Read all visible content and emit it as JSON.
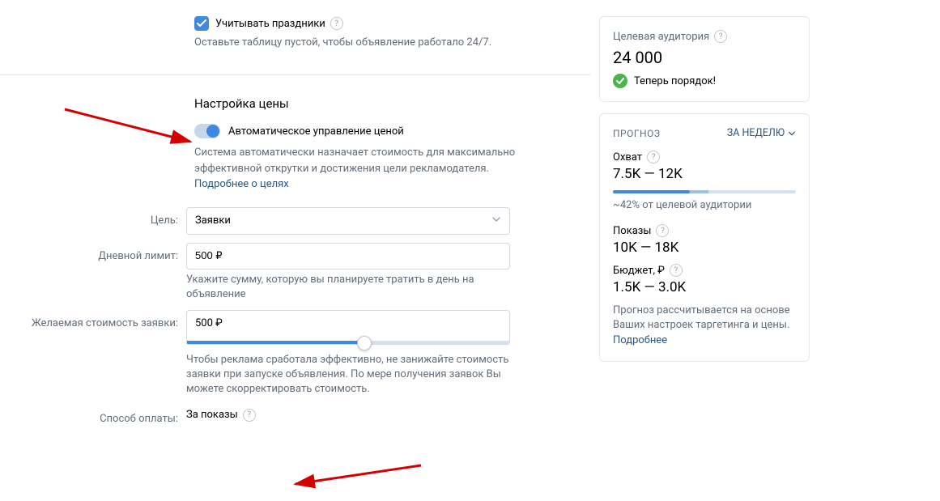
{
  "holidays": {
    "checkbox_label": "Учитывать праздники",
    "hint": "Оставьте таблицу пустой, чтобы объявление работало 24/7."
  },
  "price_section": {
    "title": "Настройка цены",
    "auto_toggle_label": "Автоматическое управление ценой",
    "auto_desc_prefix": "Система автоматически назначает стоимость для максимально эффективной открутки и достижения цели рекламодателя. ",
    "auto_desc_link": "Подробнее о целях"
  },
  "goal": {
    "label": "Цель:",
    "value": "Заявки"
  },
  "daily_limit": {
    "label": "Дневной лимит:",
    "value": "500 ₽",
    "hint": "Укажите сумму, которую вы планируете тратить в день на объявление"
  },
  "desired_cost": {
    "label": "Желаемая стоимость заявки:",
    "value": "500 ₽",
    "hint": "Чтобы реклама сработала эффективно, не занижайте стоимость заявки при запуске объявления. По мере получения заявок Вы можете скорректировать стоимость."
  },
  "payment": {
    "label": "Способ оплаты:",
    "value": "За показы"
  },
  "audience": {
    "title": "Целевая аудитория",
    "value": "24 000",
    "ok_text": "Теперь порядок!"
  },
  "forecast": {
    "title": "ПРОГНОЗ",
    "period": "ЗА НЕДЕЛЮ",
    "reach_label": "Охват",
    "reach_value": "7.5K — 12K",
    "reach_percent": "~42% от целевой аудитории",
    "impressions_label": "Показы",
    "impressions_value": "10K — 18K",
    "budget_label": "Бюджет, ₽",
    "budget_value": "1.5K — 3.0K",
    "footer_prefix": "Прогноз рассчитывается на основе Ваших настроек таргетинга и цены. ",
    "footer_link": "Подробнее"
  }
}
